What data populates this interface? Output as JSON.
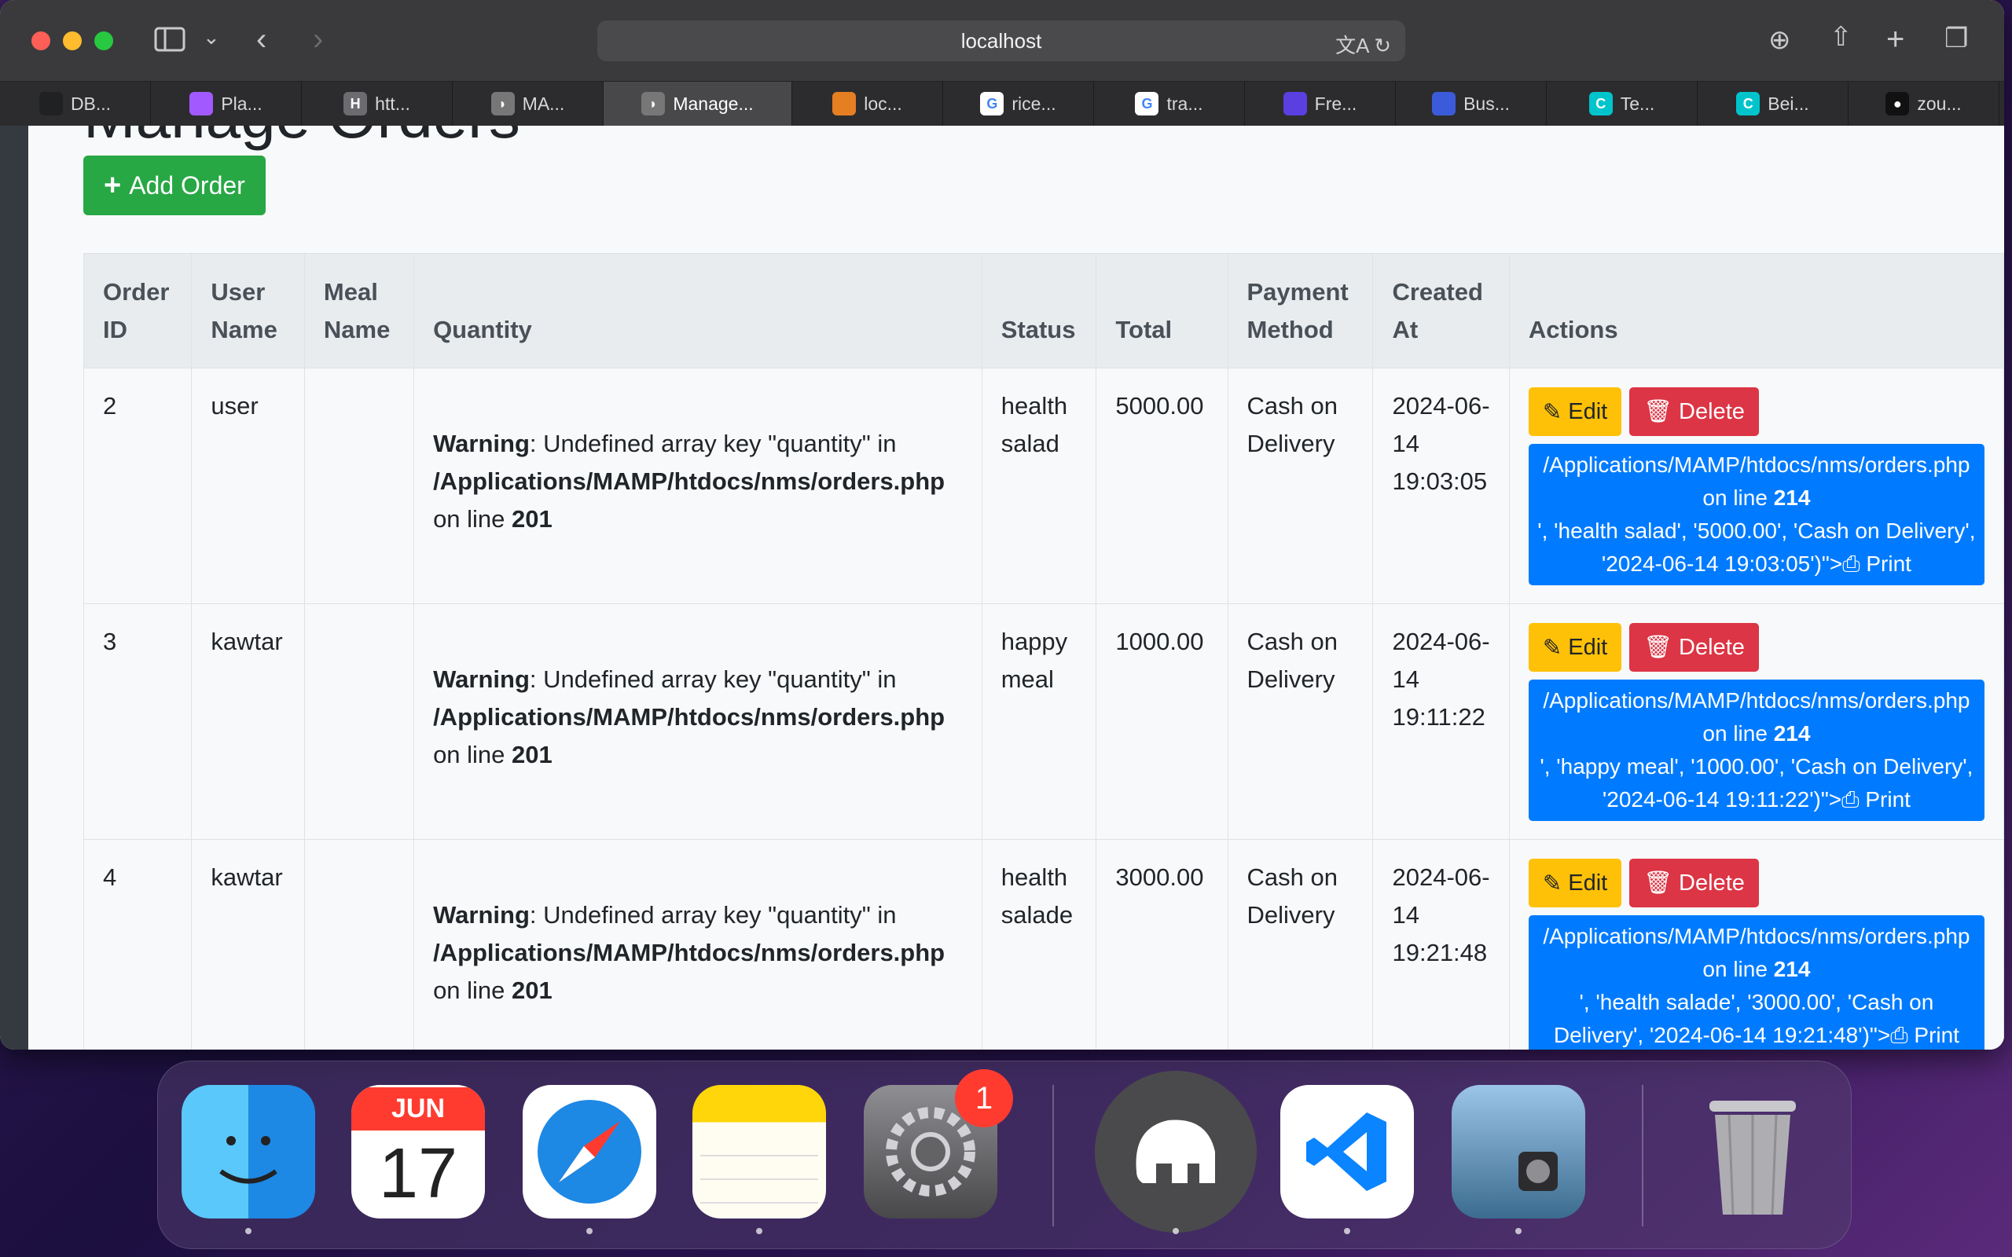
{
  "browser": {
    "url": "localhost",
    "tabs": [
      {
        "label": "DB...",
        "icon": "openai-icon",
        "color": "#202123"
      },
      {
        "label": "Pla...",
        "icon": "figma-icon",
        "color": "#a259ff"
      },
      {
        "label": "htt...",
        "icon": "h-icon",
        "color": "#6b6b70"
      },
      {
        "label": "MA...",
        "icon": "mamp-icon",
        "color": "#777"
      },
      {
        "label": "Manage...",
        "icon": "mamp-icon",
        "color": "#777",
        "active": true
      },
      {
        "label": "loc...",
        "icon": "sailboat-icon",
        "color": "#e67e22"
      },
      {
        "label": "rice...",
        "icon": "google-icon",
        "color": "#ffffff"
      },
      {
        "label": "tra...",
        "icon": "google-icon",
        "color": "#ffffff"
      },
      {
        "label": "Fre...",
        "icon": "ui-icon",
        "color": "#5b3fe0"
      },
      {
        "label": "Bus...",
        "icon": "magnet-icon",
        "color": "#3b5bdb"
      },
      {
        "label": "Te...",
        "icon": "canva-icon",
        "color": "#00c4cc"
      },
      {
        "label": "Bei...",
        "icon": "canva-icon",
        "color": "#00c4cc"
      },
      {
        "label": "zou...",
        "icon": "github-icon",
        "color": "#111"
      }
    ]
  },
  "page": {
    "title": "Manage Orders",
    "add_button": "Add Order",
    "columns": [
      "Order ID",
      "User Name",
      "Meal Name",
      "Quantity",
      "Status",
      "Total",
      "Payment Method",
      "Created At",
      "Actions"
    ],
    "warning_label": "Warning",
    "warning_text": ": Undefined array key \"quantity\" in",
    "warning_path": "/Applications/MAMP/htdocs/nms/orders.php",
    "warning_online": "on line",
    "warning_line": "201",
    "edit_label": "Edit",
    "delete_label": "Delete",
    "print_label": "Print",
    "print_path": "/Applications/MAMP/htdocs/nms/orders.php",
    "print_online": "on line",
    "print_line": "214",
    "rows": [
      {
        "id": "2",
        "user": "user",
        "meal": "",
        "status": "health salad",
        "total": "5000.00",
        "payment": "Cash on Delivery",
        "created": "2024-06-14 19:03:05",
        "print_tail": "', 'health salad', '5000.00', 'Cash on Delivery', '2024-06-14 19:03:05')\">"
      },
      {
        "id": "3",
        "user": "kawtar",
        "meal": "",
        "status": "happy meal",
        "total": "1000.00",
        "payment": "Cash on Delivery",
        "created": "2024-06-14 19:11:22",
        "print_tail": "', 'happy meal', '1000.00', 'Cash on Delivery', '2024-06-14 19:11:22')\">"
      },
      {
        "id": "4",
        "user": "kawtar",
        "meal": "",
        "status": "health salade",
        "total": "3000.00",
        "payment": "Cash on Delivery",
        "created": "2024-06-14 19:21:48",
        "print_tail": "', 'health salade', '3000.00', 'Cash on Delivery', '2024-06-14 19:21:48')\">"
      }
    ]
  },
  "dock": {
    "calendar_month": "JUN",
    "calendar_day": "17",
    "settings_badge": "1",
    "apps": [
      "finder-icon",
      "calendar-icon",
      "safari-icon",
      "notes-icon",
      "settings-icon",
      "mamp-icon",
      "vscode-icon",
      "preview-icon",
      "trash-icon"
    ]
  }
}
